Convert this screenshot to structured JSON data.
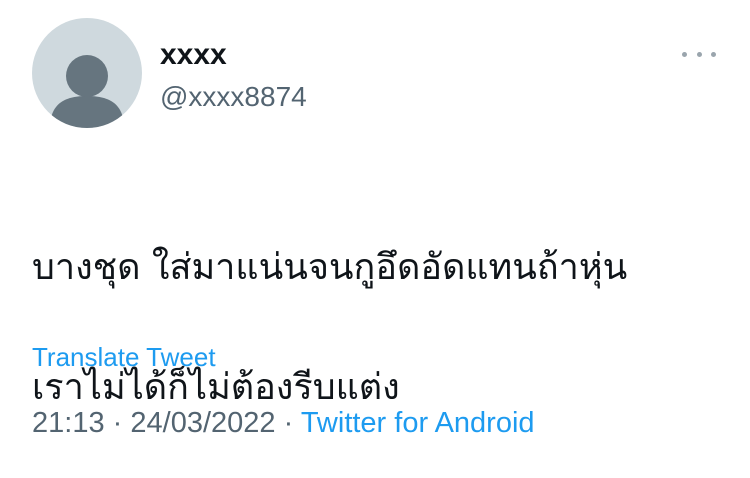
{
  "author": {
    "display_name": "xxxx",
    "handle": "@xxxx8874",
    "avatar_icon": "default-avatar-icon"
  },
  "menu": {
    "icon": "more-options-icon"
  },
  "tweet": {
    "text_line_1": "บางชุด ใส่มาแน่นจนกูอึดอัดแทนถ้าหุ่น",
    "text_line_2": "เราไม่ได้ก็ไม่ต้องรีบแต่ง",
    "translate_label": "Translate Tweet"
  },
  "meta": {
    "time": "21:13",
    "separator": "·",
    "date": "24/03/2022",
    "source": "Twitter for Android"
  },
  "colors": {
    "link": "#1d9bf0",
    "secondary_text": "#536471",
    "avatar_bg": "#cfd9de",
    "avatar_figure": "#66757f"
  }
}
